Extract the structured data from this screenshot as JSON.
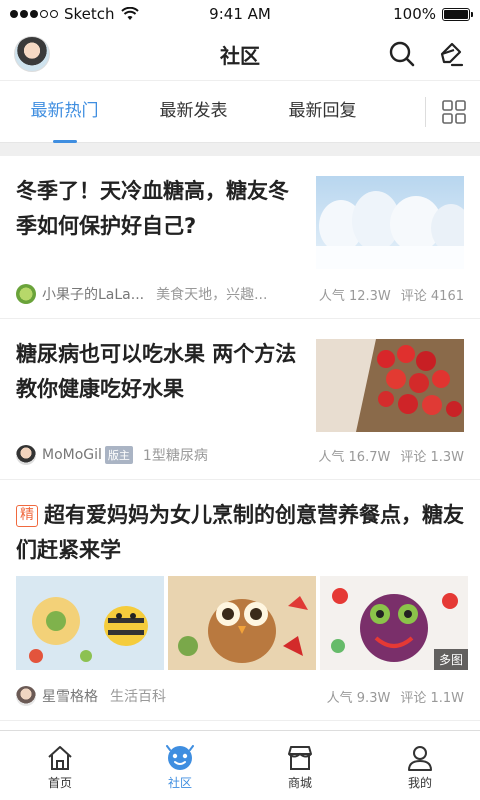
{
  "status_bar": {
    "carrier": "Sketch",
    "time": "9:41 AM",
    "battery": "100%"
  },
  "header": {
    "title": "社区"
  },
  "tabs": [
    {
      "label": "最新热门",
      "active": true
    },
    {
      "label": "最新发表",
      "active": false
    },
    {
      "label": "最新回复",
      "active": false
    }
  ],
  "posts": [
    {
      "title": "冬季了！天冷血糖高，糖友冬季如何保护好自己?",
      "author": "小果子的LaLa...",
      "group": "美食天地，兴趣...",
      "popularity": "人气 12.3W",
      "comments": "评论 4161"
    },
    {
      "title": "糖尿病也可以吃水果 两个方法教你健康吃好水果",
      "author": "MoMoGil",
      "author_badge": "版主",
      "group": "1型糖尿病",
      "popularity": "人气 16.7W",
      "comments": "评论 1.3W"
    },
    {
      "badge": "精",
      "title": "超有爱妈妈为女儿烹制的创意营养餐点，糖友们赶紧来学",
      "more_label": "多图",
      "author": "星雪格格",
      "group": "生活百科",
      "popularity": "人气 9.3W",
      "comments": "评论 1.1W"
    }
  ],
  "tabbar": [
    {
      "label": "首页",
      "icon": "home-icon",
      "active": false
    },
    {
      "label": "社区",
      "icon": "community-icon",
      "active": true
    },
    {
      "label": "商城",
      "icon": "store-icon",
      "active": false
    },
    {
      "label": "我的",
      "icon": "profile-icon",
      "active": false
    }
  ],
  "colors": {
    "accent": "#3f8ee0",
    "badge_orange": "#f0693e"
  }
}
